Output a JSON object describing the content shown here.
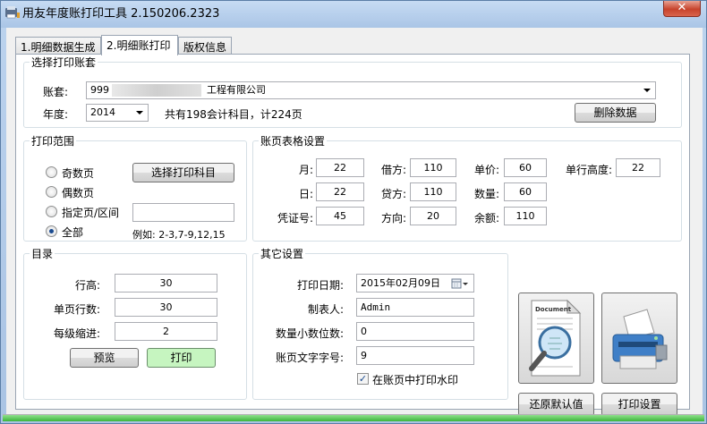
{
  "window": {
    "title": "用友年度账打印工具 2.150206.2323",
    "close_label": "✕"
  },
  "tabs": [
    {
      "label": "1.明细数据生成",
      "active": false
    },
    {
      "label": "2.明细账打印",
      "active": true
    },
    {
      "label": "版权信息",
      "active": false
    }
  ],
  "account_set": {
    "legend": "选择打印账套",
    "account_label": "账套:",
    "account_prefix": "999",
    "account_suffix": "工程有限公司",
    "year_label": "年度:",
    "year_value": "2014",
    "summary": "共有198会计科目，计224页",
    "delete_button": "删除数据"
  },
  "print_range": {
    "legend": "打印范围",
    "options": [
      {
        "label": "奇数页",
        "checked": false
      },
      {
        "label": "偶数页",
        "checked": false
      },
      {
        "label": "指定页/区间",
        "checked": false
      },
      {
        "label": "全部",
        "checked": true
      }
    ],
    "select_subject_button": "选择打印科目",
    "range_value": "",
    "example": "例如: 2-3,7-9,12,15"
  },
  "ledger_settings": {
    "legend": "账页表格设置",
    "fields": [
      {
        "label": "月:",
        "value": "22"
      },
      {
        "label": "借方:",
        "value": "110"
      },
      {
        "label": "单价:",
        "value": "60"
      },
      {
        "label": "单行高度:",
        "value": "22"
      },
      {
        "label": "日:",
        "value": "22"
      },
      {
        "label": "贷方:",
        "value": "110"
      },
      {
        "label": "数量:",
        "value": "60"
      },
      {
        "label": "凭证号:",
        "value": "45"
      },
      {
        "label": "方向:",
        "value": "20"
      },
      {
        "label": "余额:",
        "value": "110"
      }
    ]
  },
  "toc": {
    "legend": "目录",
    "row_height_label": "行高:",
    "row_height_value": "30",
    "rows_per_page_label": "单页行数:",
    "rows_per_page_value": "30",
    "indent_label": "每级缩进:",
    "indent_value": "2",
    "preview_button": "预览",
    "print_button": "打印"
  },
  "other": {
    "legend": "其它设置",
    "print_date_label": "打印日期:",
    "print_date_value": "2015年02月09日",
    "creator_label": "制表人:",
    "creator_value": "Admin",
    "qty_decimals_label": "数量小数位数:",
    "qty_decimals_value": "0",
    "font_size_label": "账页文字字号:",
    "font_size_value": "9",
    "watermark_label": "在账页中打印水印",
    "watermark_checked": true
  },
  "actions": {
    "document_icon_caption": "Document",
    "restore_button": "还原默认值",
    "print_settings_button": "打印设置"
  },
  "colors": {
    "print_button_bg": "#c6f5c0",
    "status_green": "#3cb53a"
  }
}
